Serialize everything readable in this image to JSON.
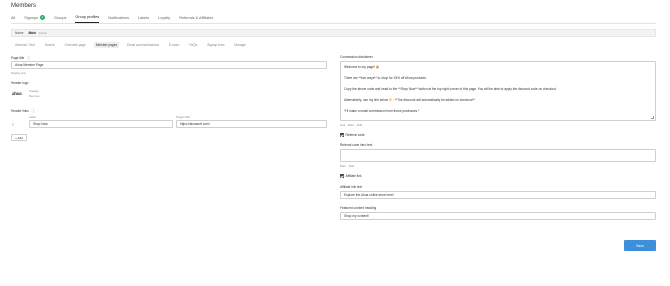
{
  "page": {
    "title": "Members"
  },
  "main_tabs": [
    {
      "label": "All"
    },
    {
      "label": "Signups",
      "badge": "1"
    },
    {
      "label": "Groups"
    },
    {
      "label": "Group profiles"
    },
    {
      "label": "Notifications"
    },
    {
      "label": "Labels"
    },
    {
      "label": "Loyalty"
    },
    {
      "label": "Referrals & Affiliates"
    }
  ],
  "group_bar": {
    "label": "Name",
    "name": "Main",
    "tag": "default"
  },
  "sub_tabs": [
    {
      "label": "General / Test"
    },
    {
      "label": "Orders"
    },
    {
      "label": "Overview page"
    },
    {
      "label": "Member pages"
    },
    {
      "label": "Email communications"
    },
    {
      "label": "E-store"
    },
    {
      "label": "FAQs"
    },
    {
      "label": "Signup form"
    },
    {
      "label": "Manage"
    }
  ],
  "left": {
    "page_title_label": "Page title",
    "page_title_value": "Ahua Member Page",
    "display_icon": "Display icon",
    "header_logo_label": "Header logo",
    "logo_text": "ahua",
    "logo_change": "Change",
    "logo_remove": "Remove",
    "header_links_label": "Header links",
    "col_label": "Label",
    "col_target": "Target URL",
    "link_label_value": "Shop Now",
    "link_target_value": "https://ahuasurf.com/",
    "add_button": "+ Add"
  },
  "right": {
    "commission_label": "Commission disclaimer",
    "commission_lines": [
      "Welcome to my page! 🎉",
      "There are **two ways** to shop for 15% off Ahua products:",
      "Copy the above code and head to the **Shop Now** button at the top right corner of this page. You will be able to apply the discount code on checkout.",
      "Alternatively, use my link below 👇. **The discount will automatically be added on checkout**",
      "*I'll make a small commission from these purchases.*"
    ],
    "edit_links": [
      "Link",
      "Bold",
      "Italic"
    ],
    "referral_code_checkbox": "Referral code",
    "referral_intro_label": "Referral code intro text",
    "referral_intro_value": "",
    "edit_links_2": [
      "Bold",
      "Italic"
    ],
    "affiliate_link_checkbox": "Affiliate link",
    "affiliate_link_text_label": "Affiliate link text",
    "affiliate_link_text_value": "Explore the Ahua online store here!",
    "featured_heading_label": "Featured content heading",
    "featured_heading_value": "Shop my content!",
    "save_button": "Save"
  }
}
